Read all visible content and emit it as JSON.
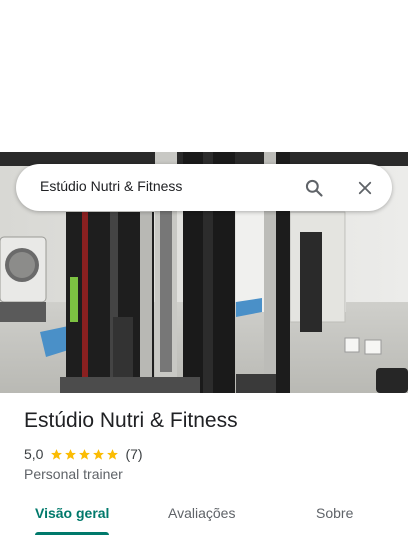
{
  "search": {
    "query": "Estúdio Nutri & Fitness",
    "search_icon": "search-icon",
    "close_icon": "close-icon"
  },
  "photo": {
    "description_icon": "gym-photo"
  },
  "place": {
    "name": "Estúdio Nutri & Fitness",
    "rating": "5,0",
    "stars": 5,
    "review_count": "(7)",
    "category": "Personal trainer"
  },
  "tabs": [
    {
      "label": "Visão geral",
      "active": true
    },
    {
      "label": "Avaliações",
      "active": false
    },
    {
      "label": "Sobre",
      "active": false
    }
  ],
  "colors": {
    "accent": "#00796b",
    "star": "#fbbc04",
    "text_primary": "#202124",
    "text_secondary": "#5f6368"
  }
}
